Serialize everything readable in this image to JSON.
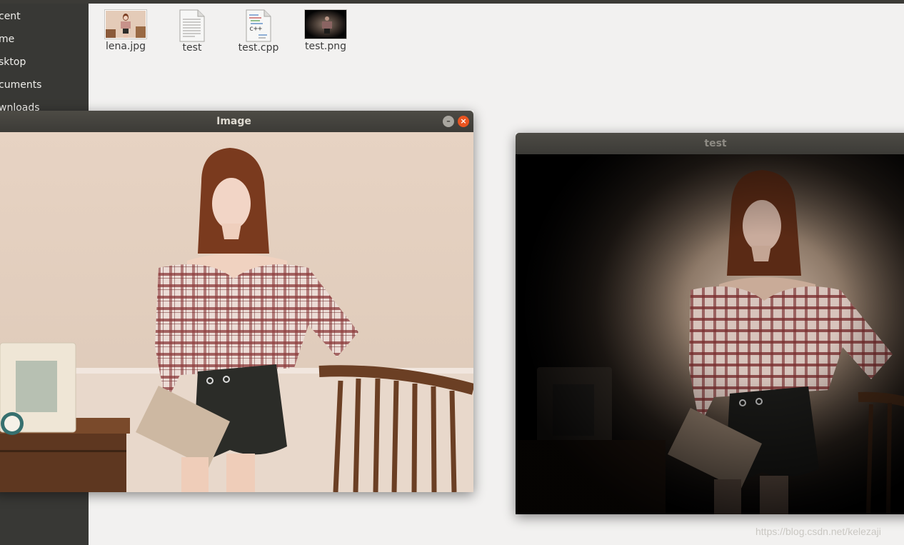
{
  "sidebar": {
    "items": [
      {
        "label": "cent"
      },
      {
        "label": "me"
      },
      {
        "label": "sktop"
      },
      {
        "label": "cuments"
      },
      {
        "label": "wnloads"
      }
    ]
  },
  "files": [
    {
      "name": "lena.jpg",
      "icon": "photo-thumbnail-icon"
    },
    {
      "name": "test",
      "icon": "text-document-icon"
    },
    {
      "name": "test.cpp",
      "icon": "cpp-source-icon",
      "badge": "c++"
    },
    {
      "name": "test.png",
      "icon": "dark-photo-thumbnail-icon"
    }
  ],
  "image_window": {
    "title": "Image"
  },
  "test_window": {
    "title": "test"
  },
  "watermark": "https://blog.csdn.net/kelezaji",
  "colors": {
    "close": "#e95420",
    "titlebar": "#3c3b37",
    "sidebar": "#383835"
  }
}
